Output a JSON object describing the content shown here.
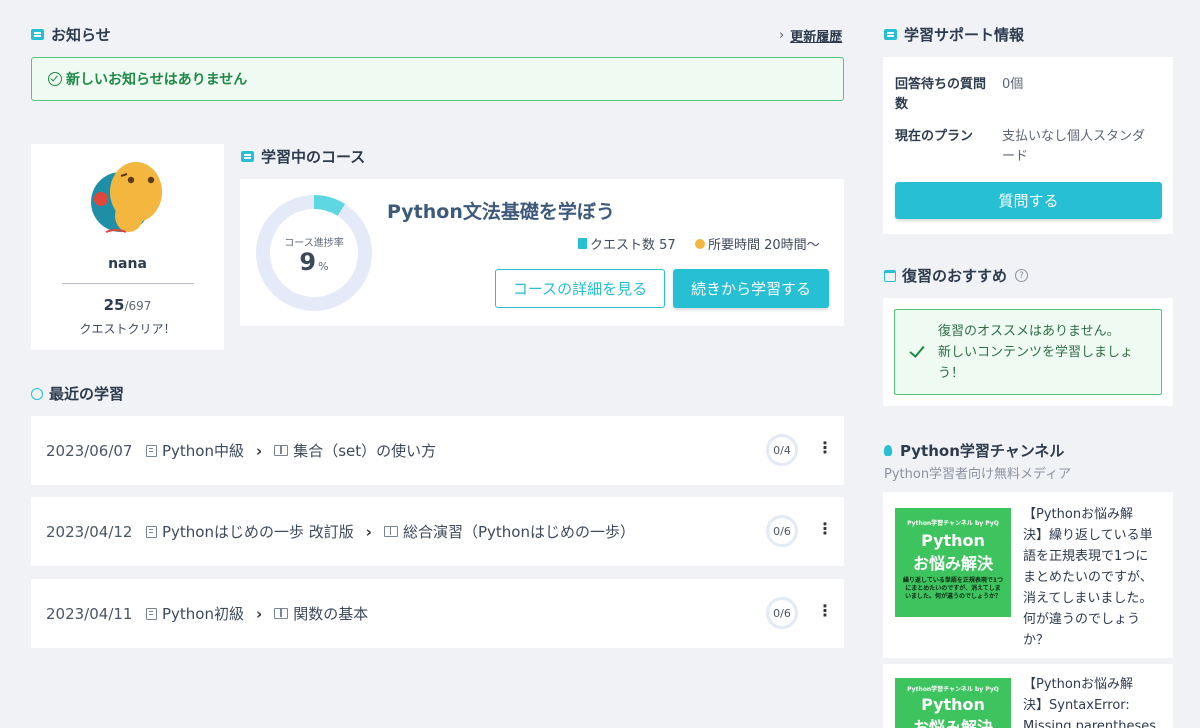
{
  "notices": {
    "title": "お知らせ",
    "history_link": "更新履歴",
    "message": "新しいお知らせはありません"
  },
  "profile": {
    "username": "nana",
    "cleared": "25",
    "total": "/697",
    "cleared_label": "クエストクリア！"
  },
  "course": {
    "section_title": "学習中のコース",
    "progress_label": "コース進捗率",
    "progress_value": "9",
    "progress_unit": "%",
    "progress_fraction": 0.09,
    "name": "Python文法基礎を学ぼう",
    "quest_count": "クエスト数 57",
    "time_required": "所要時間 20時間〜",
    "detail_button": "コースの詳細を見る",
    "continue_button": "続きから学習する"
  },
  "recent": {
    "title": "最近の学習",
    "rows": [
      {
        "date": "2023/06/07",
        "course": "Python中級",
        "lesson": "集合（set）の使い方",
        "progress": "0/4"
      },
      {
        "date": "2023/04/12",
        "course": "Pythonはじめの一歩 改訂版",
        "lesson": "総合演習（Pythonはじめの一歩）",
        "progress": "0/6"
      },
      {
        "date": "2023/04/11",
        "course": "Python初級",
        "lesson": "関数の基本",
        "progress": "0/6"
      }
    ]
  },
  "support": {
    "title": "学習サポート情報",
    "pending_label_1": "回答待ちの質問",
    "pending_label_2": "数",
    "pending_value": "0個",
    "plan_label": "現在のプラン",
    "plan_value_1": "支払いなし個人スタンダ",
    "plan_value_2": "ード",
    "ask_button": "質問する"
  },
  "review": {
    "title": "復習のおすすめ",
    "line1": "復習のオススメはありません。",
    "line2": "新しいコンテンツを学習しましょ",
    "line3": "う！"
  },
  "channel": {
    "title": "Python学習チャンネル",
    "subtitle": "Python学習者向け無料メディア",
    "articles": [
      {
        "thumb_top": "Python学習チャンネル by PyQ",
        "thumb_title_1": "Python",
        "thumb_title_2": "お悩み解決",
        "thumb_desc": "繰り返している単語を正規表現で1つにまとめたいのですが、消えてしまいました。何が違うのでしょうか？",
        "lines": [
          "【Pythonお悩み解",
          "決】繰り返している単",
          "語を正規表現で1つに",
          "まとめたいのですが、",
          "消えてしまいました。",
          "何が違うのでしょう",
          "か？"
        ]
      },
      {
        "thumb_top": "Python学習チャンネル by PyQ",
        "thumb_title_1": "Python",
        "thumb_title_2": "お悩み解決",
        "lines": [
          "【Pythonお悩み解",
          "決】SyntaxError:",
          "Missing parentheses"
        ]
      }
    ]
  },
  "colors": {
    "accent": "#26bfd3",
    "success": "#54c67a",
    "text": "#2d3b4e",
    "background": "#f1f2f5"
  }
}
